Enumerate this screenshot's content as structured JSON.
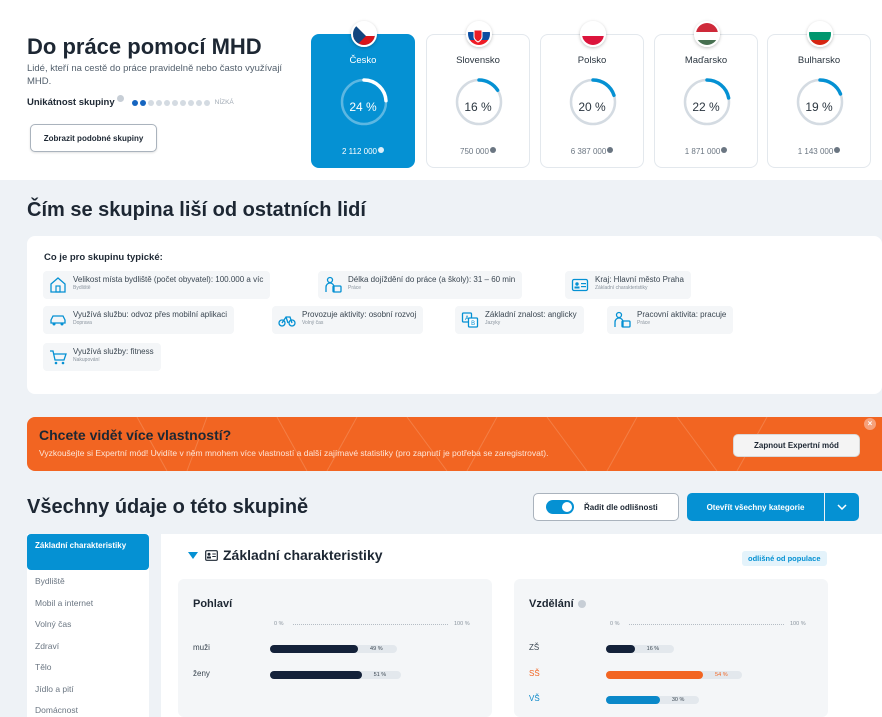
{
  "header": {
    "title": "Do práce pomocí MHD",
    "description": "Lidé, kteří na cestě do práce pravidelně nebo často využívají MHD.",
    "uniqueness_label": "Unikátnost skupiny",
    "uniqueness_level_text": "NÍZKÁ",
    "uniqueness_dots_filled": 2,
    "uniqueness_dots_total": 10,
    "similar_button": "Zobrazit podobné skupiny"
  },
  "countries": [
    {
      "name": "Česko",
      "percent": 24,
      "percent_text": "24 %",
      "count": "2 112 000",
      "selected": true,
      "flag": "czech-flag"
    },
    {
      "name": "Slovensko",
      "percent": 16,
      "percent_text": "16 %",
      "count": "750 000",
      "selected": false,
      "flag": "slovak-flag"
    },
    {
      "name": "Polsko",
      "percent": 20,
      "percent_text": "20 %",
      "count": "6 387 000",
      "selected": false,
      "flag": "polish-flag"
    },
    {
      "name": "Maďarsko",
      "percent": 22,
      "percent_text": "22 %",
      "count": "1 871 000",
      "selected": false,
      "flag": "hungarian-flag"
    },
    {
      "name": "Bulharsko",
      "percent": 19,
      "percent_text": "19 %",
      "count": "1 143 000",
      "selected": false,
      "flag": "bulgarian-flag"
    }
  ],
  "differences": {
    "heading": "Čím se skupina liší od ostatních lidí",
    "typical_title": "Co je pro skupinu typické:",
    "tags": [
      {
        "label": "Velikost místa bydliště (počet obyvatel): 100.000 a víc",
        "category": "Bydliště",
        "icon": "house-icon"
      },
      {
        "label": "Délka dojíždění do práce (a školy): 31 – 60 min",
        "category": "Práce",
        "icon": "worker-icon"
      },
      {
        "label": "Kraj: Hlavní město Praha",
        "category": "Základní charakteristiky",
        "icon": "id-card-icon"
      },
      {
        "label": "Využívá službu: odvoz přes mobilní aplikaci",
        "category": "Doprava",
        "icon": "car-icon"
      },
      {
        "label": "Provozuje aktivity: osobní rozvoj",
        "category": "Volný čas",
        "icon": "bicycle-icon"
      },
      {
        "label": "Základní znalost: anglicky",
        "category": "Jazyky",
        "icon": "language-icon"
      },
      {
        "label": "Pracovní aktivita: pracuje",
        "category": "Práce",
        "icon": "worker-icon"
      },
      {
        "label": "Využívá služby: fitness",
        "category": "Nakupování",
        "icon": "cart-icon"
      }
    ]
  },
  "promo": {
    "title": "Chcete vidět více vlastností?",
    "subtitle": "Vyzkoušejte si Expertní mód! Uvidíte v něm mnohem více vlastností a další zajímavé statistiky (pro zapnutí je potřeba se zaregistrovat).",
    "button": "Zapnout Expertní mód",
    "close": "×"
  },
  "all_data": {
    "heading": "Všechny údaje o této skupině",
    "sort_label": "Řadit dle odlišnosti",
    "sort_on": true,
    "open_all": "Otevřít všechny kategorie",
    "chevron": "⌄"
  },
  "sidebar": {
    "items": [
      "Základní charakteristiky",
      "Bydliště",
      "Mobil a internet",
      "Volný čas",
      "Zdraví",
      "Tělo",
      "Jídlo a pití",
      "Domácnost"
    ],
    "active": 0
  },
  "section": {
    "title": "Základní charakteristiky",
    "badge": "odlišné od populace"
  },
  "panels": [
    {
      "title": "Pohlaví",
      "scale_min": "0 %",
      "scale_max": "100 %",
      "rows": [
        {
          "label": "muži",
          "value": 49,
          "value_text": "49 %",
          "color": "#14223a",
          "label_color": "#3a4651"
        },
        {
          "label": "ženy",
          "value": 51,
          "value_text": "51 %",
          "color": "#14223a",
          "label_color": "#3a4651"
        }
      ]
    },
    {
      "title": "Vzdělání",
      "scale_min": "0 %",
      "scale_max": "100 %",
      "rows": [
        {
          "label": "ZŠ",
          "value": 16,
          "value_text": "16 %",
          "color": "#14223a",
          "label_color": "#3a4651"
        },
        {
          "label": "SŠ",
          "value": 54,
          "value_text": "54 %",
          "color": "#f26522",
          "label_color": "#f26522"
        },
        {
          "label": "VŠ",
          "value": 30,
          "value_text": "30 %",
          "color": "#0a88c9",
          "label_color": "#0a88c9"
        }
      ]
    }
  ]
}
